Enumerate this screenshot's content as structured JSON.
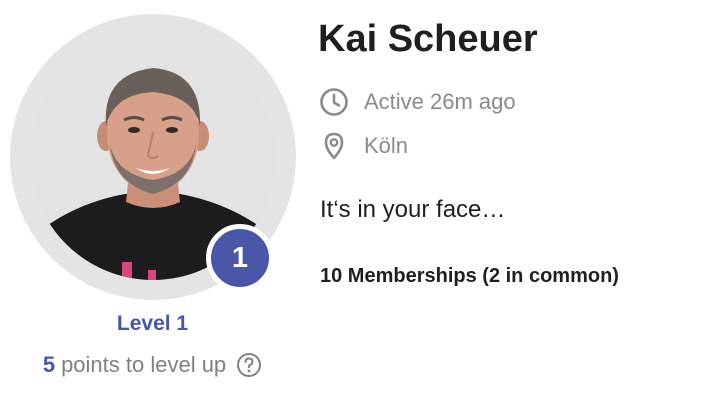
{
  "profile": {
    "name": "Kai Scheuer",
    "active_status": "Active 26m ago",
    "location": "Köln",
    "tagline": "It‘s in your face…",
    "memberships": "10 Memberships (2 in common)"
  },
  "level": {
    "badge_number": "1",
    "label": "Level 1",
    "points_value": "5",
    "points_text": "points to level up"
  },
  "icons": {
    "active": "clock-icon",
    "location": "location-pin-icon",
    "help": "question-circle-icon"
  },
  "colors": {
    "accent": "#4a57a8",
    "text": "#1f1f1f",
    "muted": "#8a8a8a",
    "ring": "#e4e4e4"
  }
}
